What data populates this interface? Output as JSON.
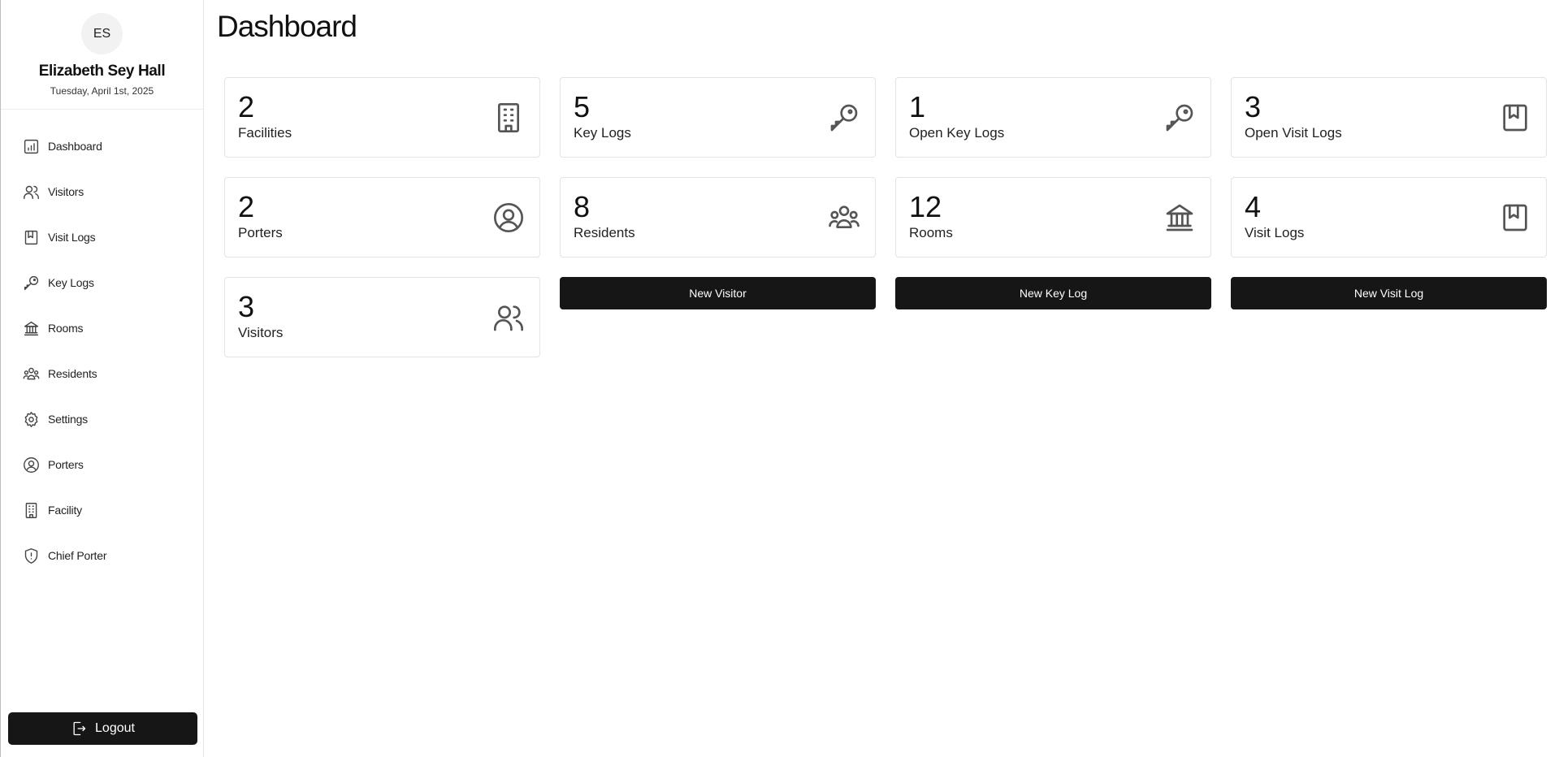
{
  "profile": {
    "initials": "ES",
    "name": "Elizabeth Sey Hall",
    "date": "Tuesday, April 1st, 2025"
  },
  "nav": {
    "items": [
      {
        "label": "Dashboard",
        "icon": "chart-icon"
      },
      {
        "label": "Visitors",
        "icon": "users-icon"
      },
      {
        "label": "Visit Logs",
        "icon": "book-icon"
      },
      {
        "label": "Key Logs",
        "icon": "key-icon"
      },
      {
        "label": "Rooms",
        "icon": "landmark-icon"
      },
      {
        "label": "Residents",
        "icon": "group-icon"
      },
      {
        "label": "Settings",
        "icon": "gear-icon"
      },
      {
        "label": "Porters",
        "icon": "user-circle-icon"
      },
      {
        "label": "Facility",
        "icon": "building-icon"
      },
      {
        "label": "Chief Porter",
        "icon": "shield-icon"
      }
    ],
    "logout_label": "Logout"
  },
  "main": {
    "title": "Dashboard",
    "cards": [
      {
        "value": "2",
        "label": "Facilities",
        "icon": "building-icon"
      },
      {
        "value": "5",
        "label": "Key Logs",
        "icon": "key-icon"
      },
      {
        "value": "1",
        "label": "Open Key Logs",
        "icon": "key-icon"
      },
      {
        "value": "3",
        "label": "Open Visit Logs",
        "icon": "book-icon"
      },
      {
        "value": "2",
        "label": "Porters",
        "icon": "user-circle-icon"
      },
      {
        "value": "8",
        "label": "Residents",
        "icon": "group-icon"
      },
      {
        "value": "12",
        "label": "Rooms",
        "icon": "landmark-icon"
      },
      {
        "value": "4",
        "label": "Visit Logs",
        "icon": "book-icon"
      },
      {
        "value": "3",
        "label": "Visitors",
        "icon": "users-icon"
      }
    ],
    "actions": {
      "new_visitor": "New Visitor",
      "new_key_log": "New Key Log",
      "new_visit_log": "New Visit Log"
    }
  }
}
